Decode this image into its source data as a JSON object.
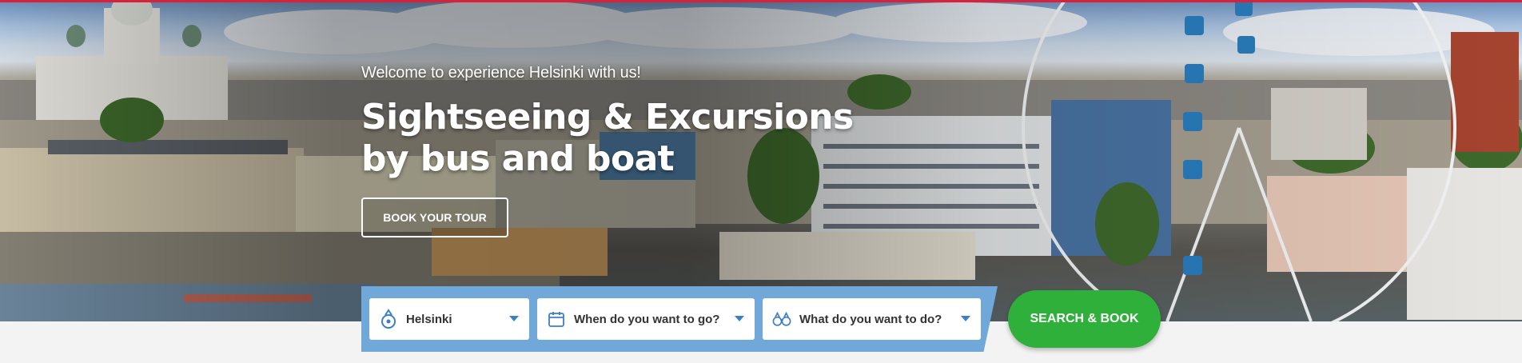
{
  "hero": {
    "welcome": "Welcome to experience Helsinki with us!",
    "headline_line1": "Sightseeing & Excursions",
    "headline_line2": "by bus and boat",
    "book_button": "BOOK YOUR TOUR"
  },
  "search": {
    "fields": [
      {
        "icon": "location-pin-icon",
        "label": "Helsinki"
      },
      {
        "icon": "calendar-icon",
        "label": "When do you want to go?"
      },
      {
        "icon": "binoculars-icon",
        "label": "What do you want to do?"
      }
    ],
    "submit": "SEARCH & BOOK"
  },
  "colors": {
    "accent_top": "#d6223a",
    "search_panel": "#6fa8d9",
    "search_button": "#2fb03a",
    "icon_blue": "#3d7fc7"
  }
}
